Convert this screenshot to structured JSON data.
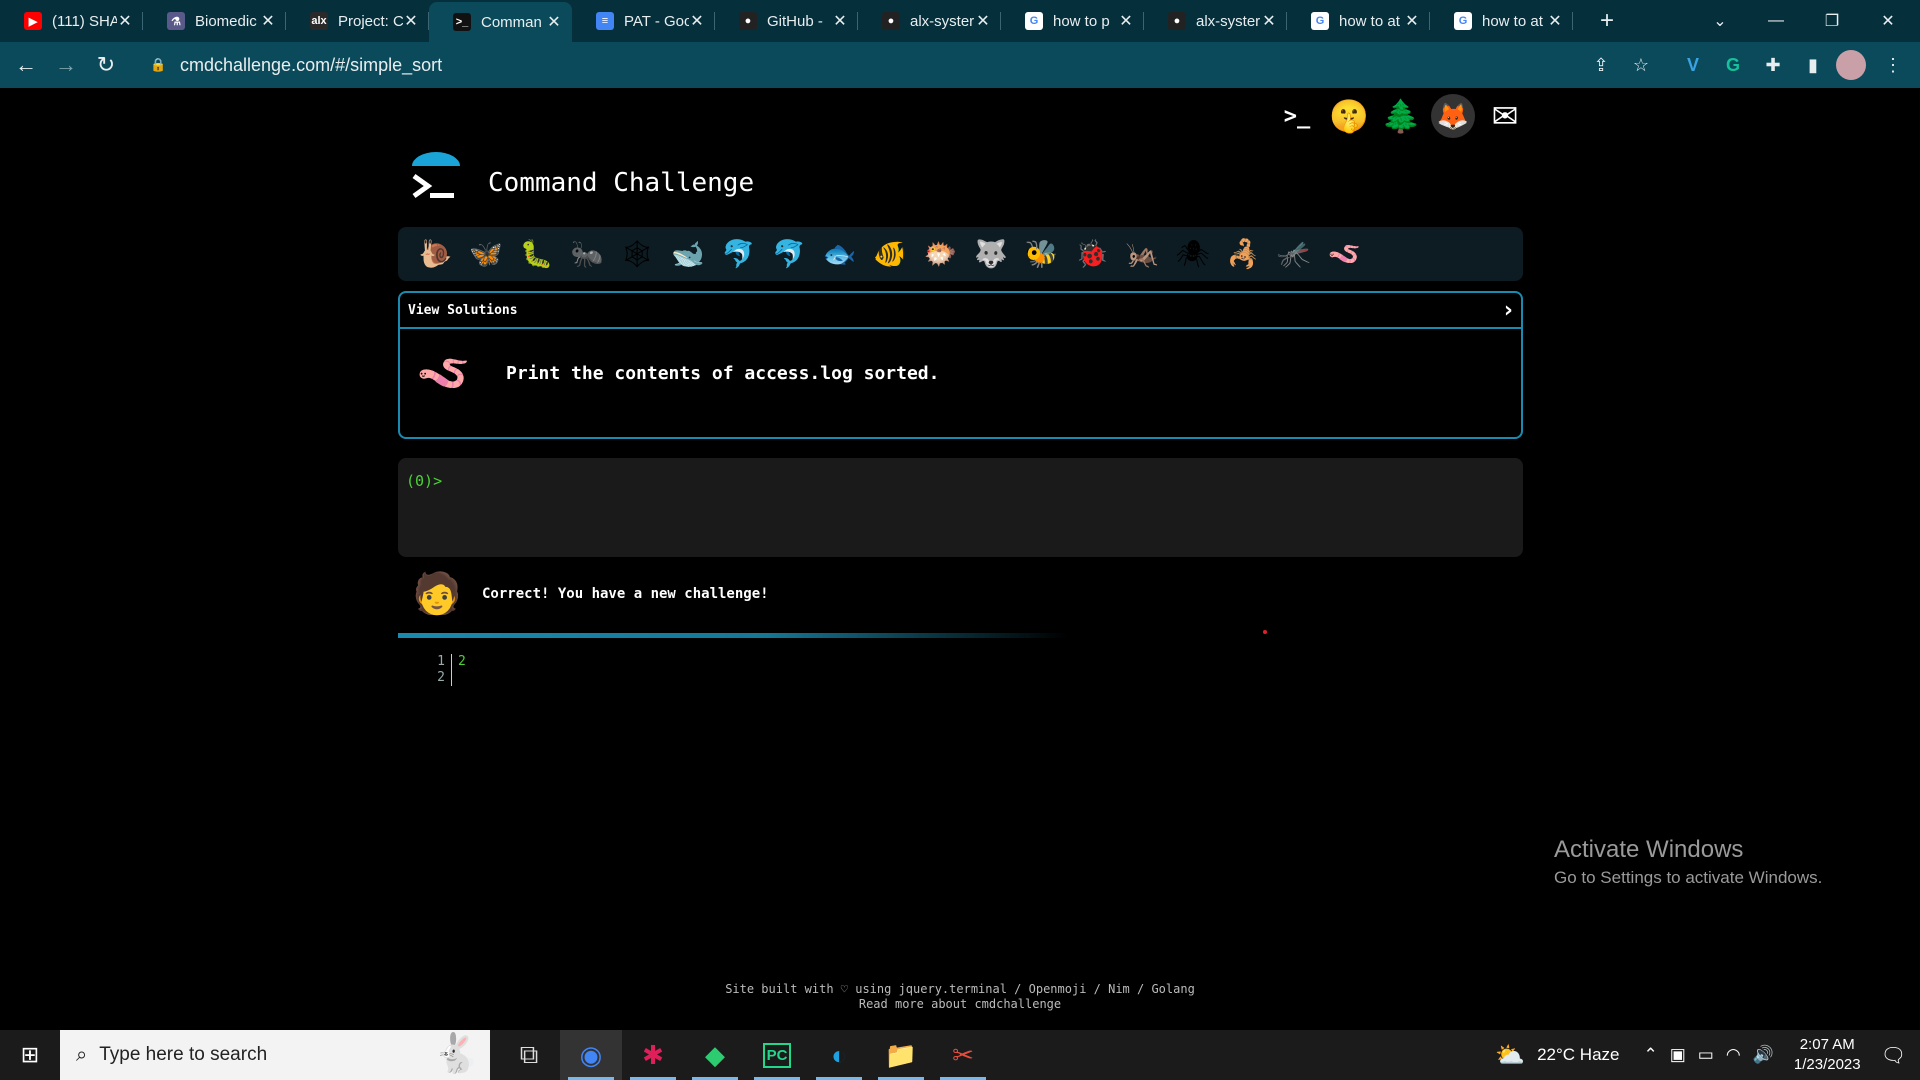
{
  "browser": {
    "tabs": [
      {
        "title": "(111) SHA",
        "favicon": "youtube-icon",
        "color": "#ff0000",
        "glyph": "▶"
      },
      {
        "title": "Biomedic",
        "favicon": "flask-icon",
        "color": "#5a5a8a",
        "glyph": "⚗"
      },
      {
        "title": "Project: C",
        "favicon": "alx-icon",
        "color": "#2a2a2a",
        "glyph": "alx"
      },
      {
        "title": "Comman",
        "favicon": "terminal-icon",
        "color": "#111111",
        "glyph": ">_",
        "active": true
      },
      {
        "title": "PAT - Goo",
        "favicon": "google-docs-icon",
        "color": "#4285f4",
        "glyph": "≡"
      },
      {
        "title": "GitHub -",
        "favicon": "github-icon",
        "color": "#222222",
        "glyph": "●"
      },
      {
        "title": "alx-syster",
        "favicon": "github-icon",
        "color": "#222222",
        "glyph": "●"
      },
      {
        "title": "how to p",
        "favicon": "google-icon",
        "color": "#ffffff",
        "glyph": "G"
      },
      {
        "title": "alx-syster",
        "favicon": "github-icon",
        "color": "#222222",
        "glyph": "●"
      },
      {
        "title": "how to at",
        "favicon": "google-icon",
        "color": "#ffffff",
        "glyph": "G"
      },
      {
        "title": "how to at",
        "favicon": "google-icon",
        "color": "#ffffff",
        "glyph": "G"
      }
    ],
    "url": "cmdchallenge.com/#/simple_sort"
  },
  "page": {
    "title": "Command Challenge",
    "top_icons": [
      "terminal-logo-icon",
      "shushing-face-icon",
      "tree-icon",
      "gitlab-icon",
      "envelope-icon"
    ],
    "top_icon_glyphs": [
      ">_",
      "🤫",
      "🌲",
      "🦊",
      "✉"
    ],
    "challenge_emojis": [
      "🐌",
      "🦋",
      "🐛",
      "🐜",
      "🕸",
      "🐋",
      "🐬",
      "🐬",
      "🐟",
      "🐠",
      "🐡",
      "🐺",
      "🐝",
      "🐞",
      "🦗",
      "🕷",
      "🦂",
      "🦟",
      "🪱"
    ],
    "view_solutions_label": "View Solutions",
    "task_emoji": "🪱",
    "task_text": "Print the contents of access.log sorted.",
    "prompt": "(0)>",
    "message_avatar": "🧑",
    "message": "Correct! You have a new challenge!",
    "editor": {
      "line_numbers": [
        "1",
        "2"
      ],
      "lines": [
        "2",
        ""
      ]
    },
    "footer_line1": "Site built with ♡ using jquery.terminal / Openmoji / Nim / Golang",
    "footer_line2": "Read more about cmdchallenge",
    "accent": "#1a8bb0"
  },
  "watermark": {
    "title": "Activate Windows",
    "subtitle": "Go to Settings to activate Windows."
  },
  "taskbar": {
    "search_placeholder": "Type here to search",
    "apps": [
      "task-view-icon",
      "chrome-icon",
      "slack-icon",
      "git-icon",
      "pycharm-icon",
      "edge-icon",
      "file-explorer-icon",
      "snip-icon"
    ],
    "app_glyphs": [
      "⧉",
      "◉",
      "✱",
      "◆",
      "PC",
      "◐",
      "📁",
      "✂"
    ],
    "weather": "22°C  Haze",
    "time": "2:07 AM",
    "date": "1/23/2023"
  }
}
